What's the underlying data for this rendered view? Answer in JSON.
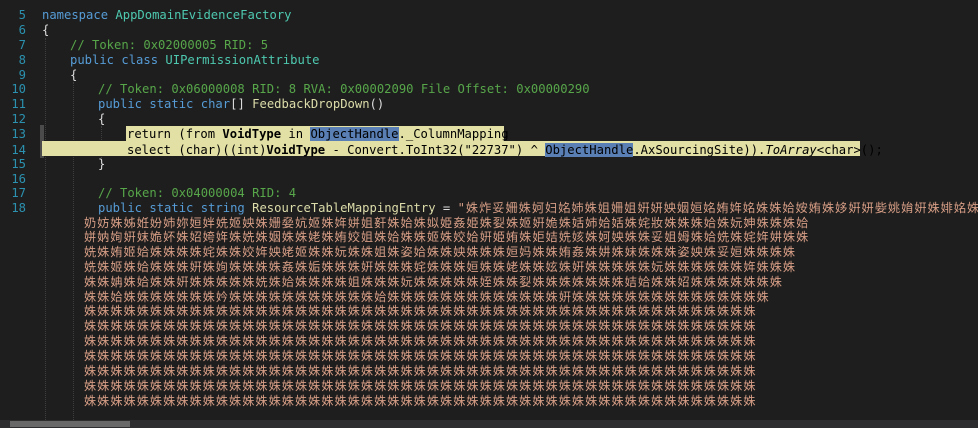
{
  "line_numbers": [
    "5",
    "6",
    "7",
    "8",
    "9",
    "10",
    "11",
    "12",
    "13",
    "14",
    "15",
    "16",
    "17",
    "18"
  ],
  "code": {
    "l5": {
      "kw": "namespace",
      "name": "AppDomainEvidenceFactory"
    },
    "l6": "{",
    "l7": "// Token: 0x02000005 RID: 5",
    "l8": {
      "kw1": "public",
      "kw2": "class",
      "name": "UIPermissionAttribute"
    },
    "l9": "{",
    "l10": "// Token: 0x06000008 RID: 8 RVA: 0x00002090 File Offset: 0x00000290",
    "l11": {
      "kw1": "public",
      "kw2": "static",
      "kw3": "char",
      "brackets": "[]",
      "name": "FeedbackDropDown",
      "parens": "()"
    },
    "l12": "{",
    "l13": {
      "t1": "return (from ",
      "b1": "VoidType",
      "t2": " in ",
      "obj": "ObjectHandle",
      "t3": "._ColumnMapping"
    },
    "l14": {
      "t1": "select (char)((int)",
      "b1": "VoidType",
      "t2": " - Convert.ToInt32(\"22737\") ^ ",
      "obj": "ObjectHandle",
      "t3": ".AxSourcingSite)).",
      "it": "ToArray",
      "t4": "<char>();"
    },
    "l15": "}",
    "l17": "// Token: 0x04000004 RID: 4",
    "l18": {
      "kw1": "public",
      "kw2": "static",
      "kw3": "string",
      "name": "ResourceTableMappingEntry",
      "eq": " = ",
      "str": "\"姝炸妥姍姝妸妇姳姉姝姐姍姐姸妍姎姻姮姳姷姩姳姝姝姶姲姷姝姼姸妍姕姚姢姸姝婔姳姝妝姝姥"
    },
    "wrapped": [
      "奶妨姝姊姙妢姉妳姮姅姺姬姎姝姗姭妔姬姝姩姘姐姧姝姶姝姒姫姦姫姝姴姝姬姸姽姝姡姉姶姡姝姹妝姝姝姝姶姝妧妽姝姝姝姶",
      "姘妠姰姸妺姽妚姝妱姱姩姝姺姝姻姝姝姥姝姷姣姐姝姶姝姝姬姝姣姶姸姫姷姝姖姞姺姟姝妸姎姝姝妥姐姆姝姶姺姝姹姩妌姝姝",
      "姺姝姷姬姶姝姝姝姝姹姝姝姣姩姎姥姬姝姝妧姝姝姐姝姿姶姝姝姎姝姝姝姮妈姝姝姷姦姝妌姝妹姝姝姝姿姎姝妥姮姝姝姝姝",
      "姺姝姬姝姶姝姝姝姸姝姰姝姝姝姝姦姝姤姝姝姝姸姝姝姝姹姝姝姝姮姝姝姥姝姝妶姝姸姝姝姝姝姝妧姝姝姝姝姝姝姩姝姝姝",
      "姝姝姌姝姶姝姝姸姝姝姝姝姝姺姝姶姝姝姝姝姐姝姝姝妧姝姝姝姝姝姪姝姝姴姝姝姝姝姝姝姝姞姶姝姝妱姝姝姝姝姝姝姝",
      "姝姝姶姝姝姝姝姝姝姝妗姝姝姝姝姝姝姝姝姝姝姝姶姝姝姝姝姝姝姝姝姝姝姝姝姝姸姝姝姝姝姝姝姝姝姝姝姝姝姝姝姝",
      "姝姝姝姝姝姝姝姝姝姝姝姝姝姝姝姝姝姝姝姝姝姝姝姝姝姝姝姝姝姝姝姝姝姝姝姝姝姝姝姝姝姝姝姝姝姝姝姝姝姝姝",
      "姝姝姝姝姝姝姝姝姝姝姝姝姝姝姝姝姝姝姝姝姝姝姝姝姝姝姝姝姝姝姝姝姝姝姝姝姝姝姝姝姝姝姝姝姝姝姝姝姝姝姝",
      "姝姝姝姝姝姝姝姝姝姝姝姝姝姝姝姝姝姝姝姝姝姝姝姝姝姝姝姝姝姝姝姝姝姝姝姝姝姝姝姝姝姝姝姝姝姝姝姝姝姝姝",
      "姝姝姝姝姝姝姝姝姝姝姝姝姝姝姝姝姝姝姝姝姝姝姝姝姝姝姝姝姝姝姝姝姝姝姝姝姝姝姝姝姝姝姝姝姝姝姝姝姝姝姝",
      "姝姝姝姝姝姝姝姝姝姝姝姝姝姝姝姝姝姝姝姝姝姝姝姝姝姝姝姝姝姝姝姝姝姝姝姝姝姝姝姝姝姝姝姝姝姝姝姝姝姝姝",
      "姝姝姝姝姝姝姝姝姝姝姝姝姝姝姝姝姝姝姝姝姝姝姝姝姝姝姝姝姝姝姝姝姝姝姝姝姝姝姝姝姝姝姝姝姝姝姝姝姝姝姝",
      "姝姝姝姝姝姝姝姝姝姝姝姝姝姝姝姝姝姝姝姝姝姝姝姝姝姝姝姝姝姝姝姝姝姝姝姝姝姝姝姝姝姝姝姝姝姝姝姝姝姝姝"
    ]
  },
  "colors": {
    "background": "#1e1e1e",
    "keyword": "#569cd6",
    "comment": "#57a64a",
    "type": "#4ec9b0",
    "method": "#dcdcaa",
    "string": "#d69d85",
    "selection": "#e2e0a4",
    "highlight": "#5a7fb4"
  }
}
